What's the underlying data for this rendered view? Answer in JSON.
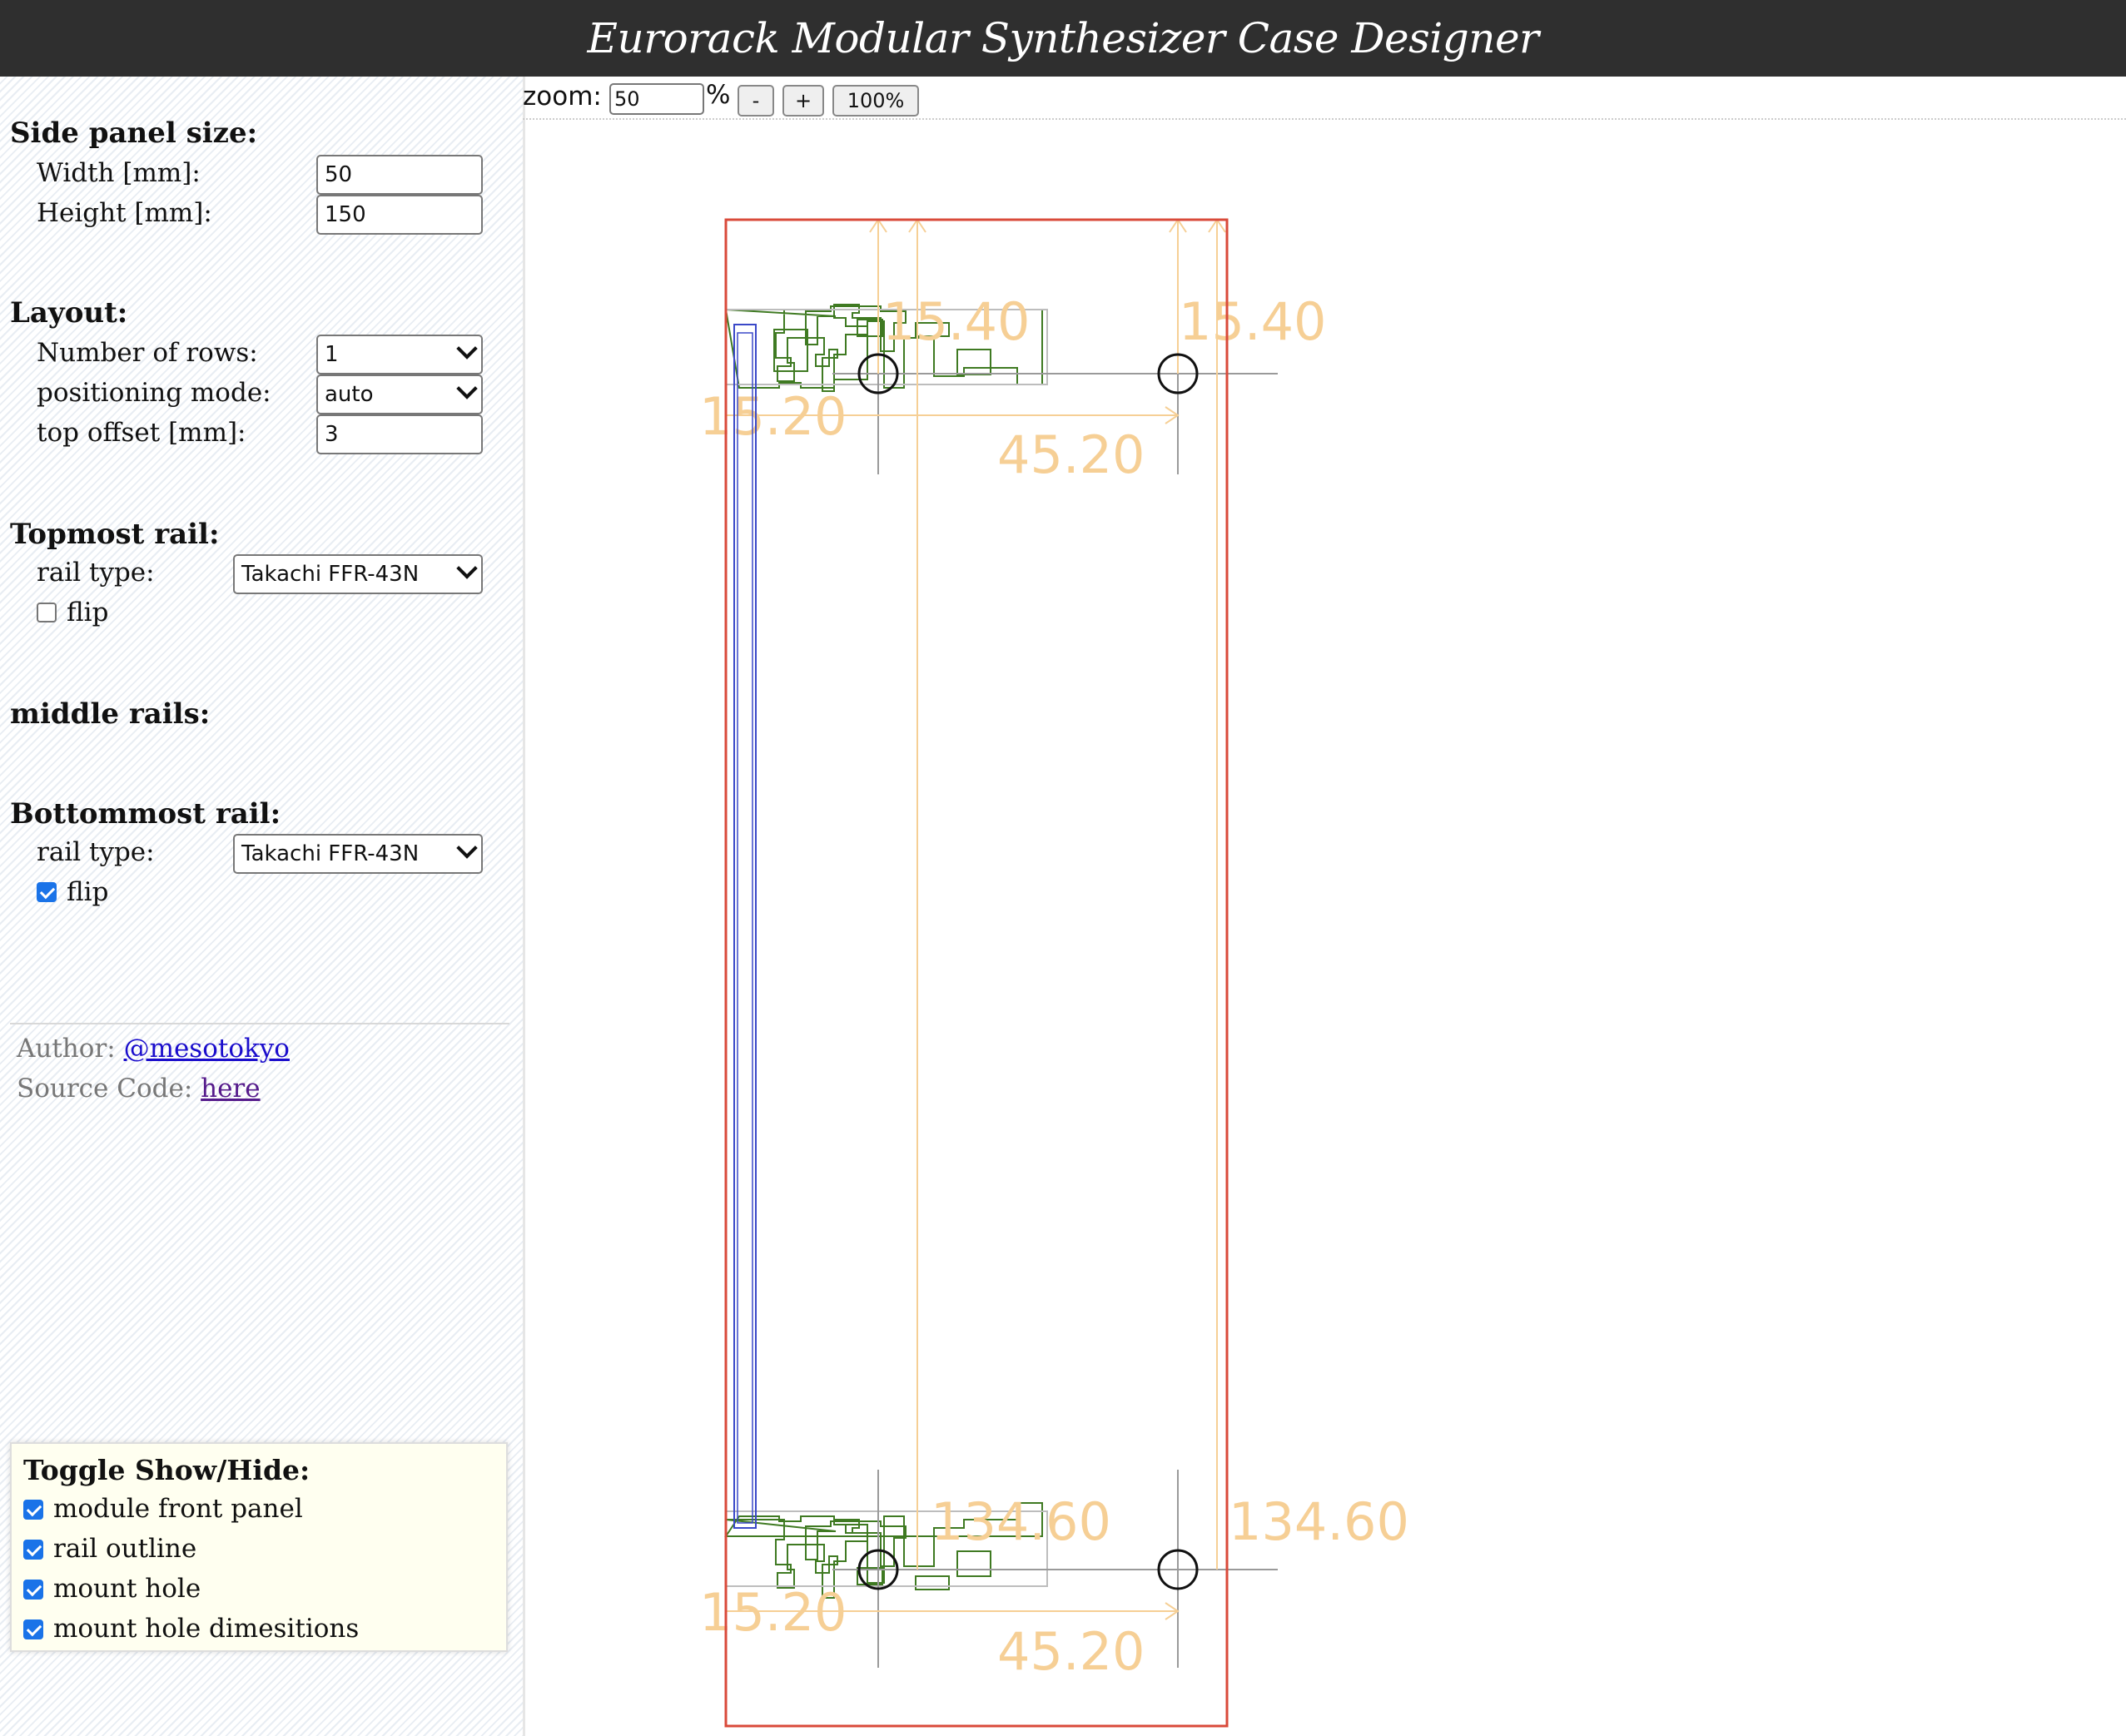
{
  "header": {
    "title": "Eurorack Modular Synthesizer Case Designer"
  },
  "side_panel": {
    "heading": "Side panel size:",
    "width_label": "Width [mm]:",
    "width_value": "50",
    "height_label": "Height [mm]:",
    "height_value": "150"
  },
  "layout": {
    "heading": "Layout:",
    "rows_label": "Number of rows:",
    "rows_value": "1",
    "mode_label": "positioning mode:",
    "mode_value": "auto",
    "offset_label": "top offset [mm]:",
    "offset_value": "3"
  },
  "topmost_rail": {
    "heading": "Topmost rail:",
    "type_label": "rail type:",
    "type_value": "Takachi FFR-43N",
    "flip_label": "flip",
    "flip_checked": false
  },
  "middle_rails": {
    "heading": "middle rails:"
  },
  "bottommost_rail": {
    "heading": "Bottommost rail:",
    "type_label": "rail type:",
    "type_value": "Takachi FFR-43N",
    "flip_label": "flip",
    "flip_checked": true
  },
  "credits": {
    "author_label": "Author:",
    "author_link": "@mesotokyo",
    "source_label": "Source Code:",
    "source_link": "here"
  },
  "toggle": {
    "heading": "Toggle Show/Hide:",
    "items": [
      {
        "label": "module front panel",
        "checked": true
      },
      {
        "label": "rail outline",
        "checked": true
      },
      {
        "label": "mount hole",
        "checked": true
      },
      {
        "label": "mount hole dimesitions",
        "checked": true
      }
    ]
  },
  "zoom": {
    "label": "zoom:",
    "value": "50",
    "unit": "%",
    "minus": "-",
    "plus": "+",
    "reset": "100%"
  },
  "drawing": {
    "top_dims": {
      "left": "15.40",
      "right": "15.40",
      "side": "15.20",
      "span": "45.20"
    },
    "bottom_dims": {
      "left": "134.60",
      "right": "134.60",
      "side": "15.20",
      "span": "45.20"
    },
    "colors": {
      "panel": "#d94a3a",
      "rail": "#3f7a22",
      "front_panel": "#3a48c8",
      "dimension": "#f6cf95",
      "hole": "#111111"
    }
  }
}
